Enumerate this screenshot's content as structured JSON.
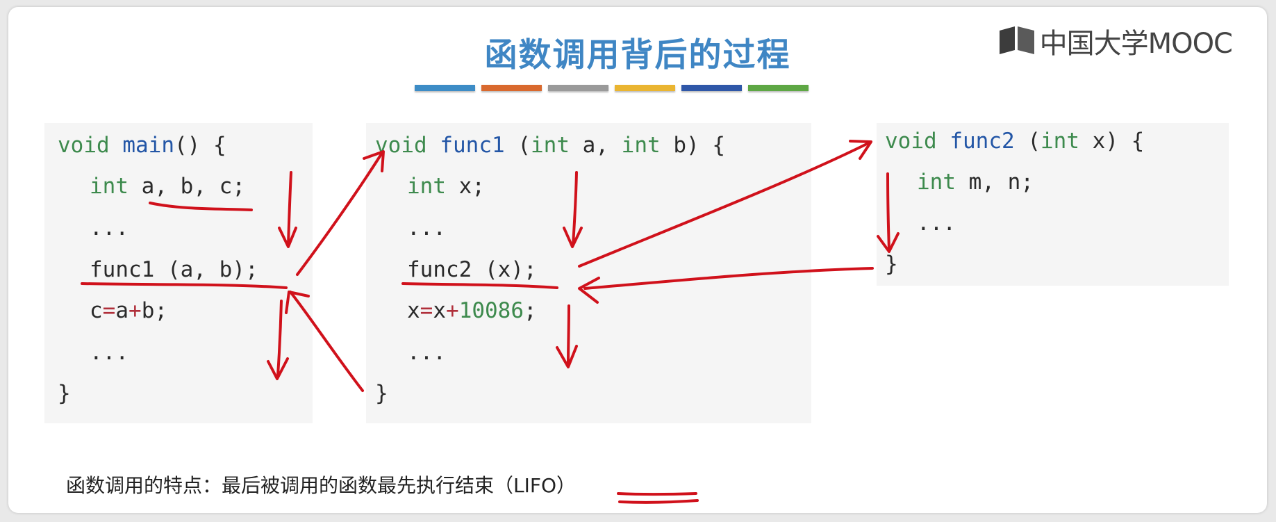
{
  "slide": {
    "title": "函数调用背后的过程",
    "accent_bar_colors": [
      "#3d8cc6",
      "#d9692e",
      "#9a9a9a",
      "#eab531",
      "#2f57a8",
      "#5ea744"
    ],
    "logo": {
      "text": "中国大学MOOC",
      "icon": "book-icon"
    },
    "caption": {
      "text": "函数调用的特点：最后被调用的函数最先执行结束（",
      "highlight": "LIFO",
      "close": "）"
    }
  },
  "code": {
    "main": {
      "l1": {
        "kw": "void",
        "fn": "main",
        "rest": "() {"
      },
      "l2": {
        "kw": "int",
        "rest": "a, b, c;"
      },
      "l3": "...",
      "l4": "func1 (a, b);",
      "l5": {
        "a": "c",
        "op1": "=",
        "b": "a",
        "op2": "+",
        "c": "b;"
      },
      "l6": "...",
      "l7": "}"
    },
    "func1": {
      "l1": {
        "kw": "void",
        "fn": "func1",
        "p1": "(",
        "kw2": "int",
        "p2": "a,",
        "kw3": "int",
        "p3": "b) {"
      },
      "l2": {
        "kw": "int",
        "rest": "x;"
      },
      "l3": "...",
      "l4": "func2 (x);",
      "l5": {
        "a": "x",
        "op1": "=",
        "b": "x",
        "op2": "+",
        "num": "10086",
        "c": ";"
      },
      "l6": "...",
      "l7": "}"
    },
    "func2": {
      "l1": {
        "kw": "void",
        "fn": "func2",
        "p1": "(",
        "kw2": "int",
        "p2": "x) {"
      },
      "l2": {
        "kw": "int",
        "rest": "m, n;"
      },
      "l3": "...",
      "l4": "}"
    }
  },
  "annotations": {
    "ink_color": "#d0111b"
  }
}
